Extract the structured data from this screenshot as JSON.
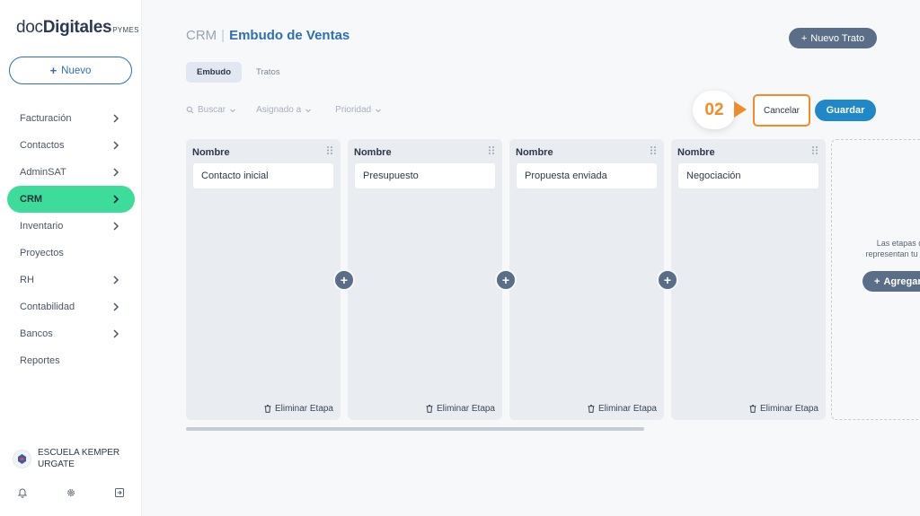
{
  "brand": {
    "part1": "doc",
    "part2": "Digitales",
    "suffix": "PYMES"
  },
  "sidebar": {
    "new_button": {
      "icon": "plus-icon",
      "label": "Nuevo"
    },
    "items": [
      {
        "label": "Facturación",
        "chevron": true
      },
      {
        "label": "Contactos",
        "chevron": true
      },
      {
        "label": "AdminSAT",
        "chevron": true
      },
      {
        "label": "CRM",
        "chevron": true,
        "active": true
      },
      {
        "label": "Inventario",
        "chevron": true
      },
      {
        "label": "Proyectos",
        "chevron": false
      },
      {
        "label": "RH",
        "chevron": true
      },
      {
        "label": "Contabilidad",
        "chevron": true
      },
      {
        "label": "Bancos",
        "chevron": true
      },
      {
        "label": "Reportes",
        "chevron": false
      }
    ],
    "user": {
      "name": "ESCUELA KEMPER URGATE"
    },
    "footer_icons": [
      "bell-icon",
      "gear-icon",
      "logout-icon"
    ]
  },
  "header": {
    "breadcrumb_root": "CRM",
    "separator": "|",
    "breadcrumb_current": "Embudo de Ventas",
    "new_deal_label": "Nuevo Trato"
  },
  "tabs": [
    {
      "label": "Embudo",
      "active": true
    },
    {
      "label": "Tratos",
      "active": false
    }
  ],
  "filters": {
    "search": "Buscar",
    "assigned": "Asignado a",
    "priority": "Prioridad"
  },
  "actions": {
    "callout": "02",
    "cancel": "Cancelar",
    "save": "Guardar"
  },
  "stages": [
    {
      "header": "Nombre",
      "name": "Contacto inicial",
      "delete_label": "Eliminar Etapa"
    },
    {
      "header": "Nombre",
      "name": "Presupuesto",
      "delete_label": "Eliminar Etapa"
    },
    {
      "header": "Nombre",
      "name": "Propuesta enviada",
      "delete_label": "Eliminar Etapa"
    },
    {
      "header": "Nombre",
      "name": "Negociación",
      "delete_label": "Eliminar Etapa"
    }
  ],
  "new_stage": {
    "hint_line1": "Las etapas del",
    "hint_line2": "representan tu proce",
    "add_label": "Agregar"
  },
  "colors": {
    "accent_blue": "#2f6fb1",
    "active_green": "#3ddc9a",
    "highlight_orange": "#f28c28",
    "save_blue": "#1e88c8",
    "slate_button": "#5a6f87"
  }
}
